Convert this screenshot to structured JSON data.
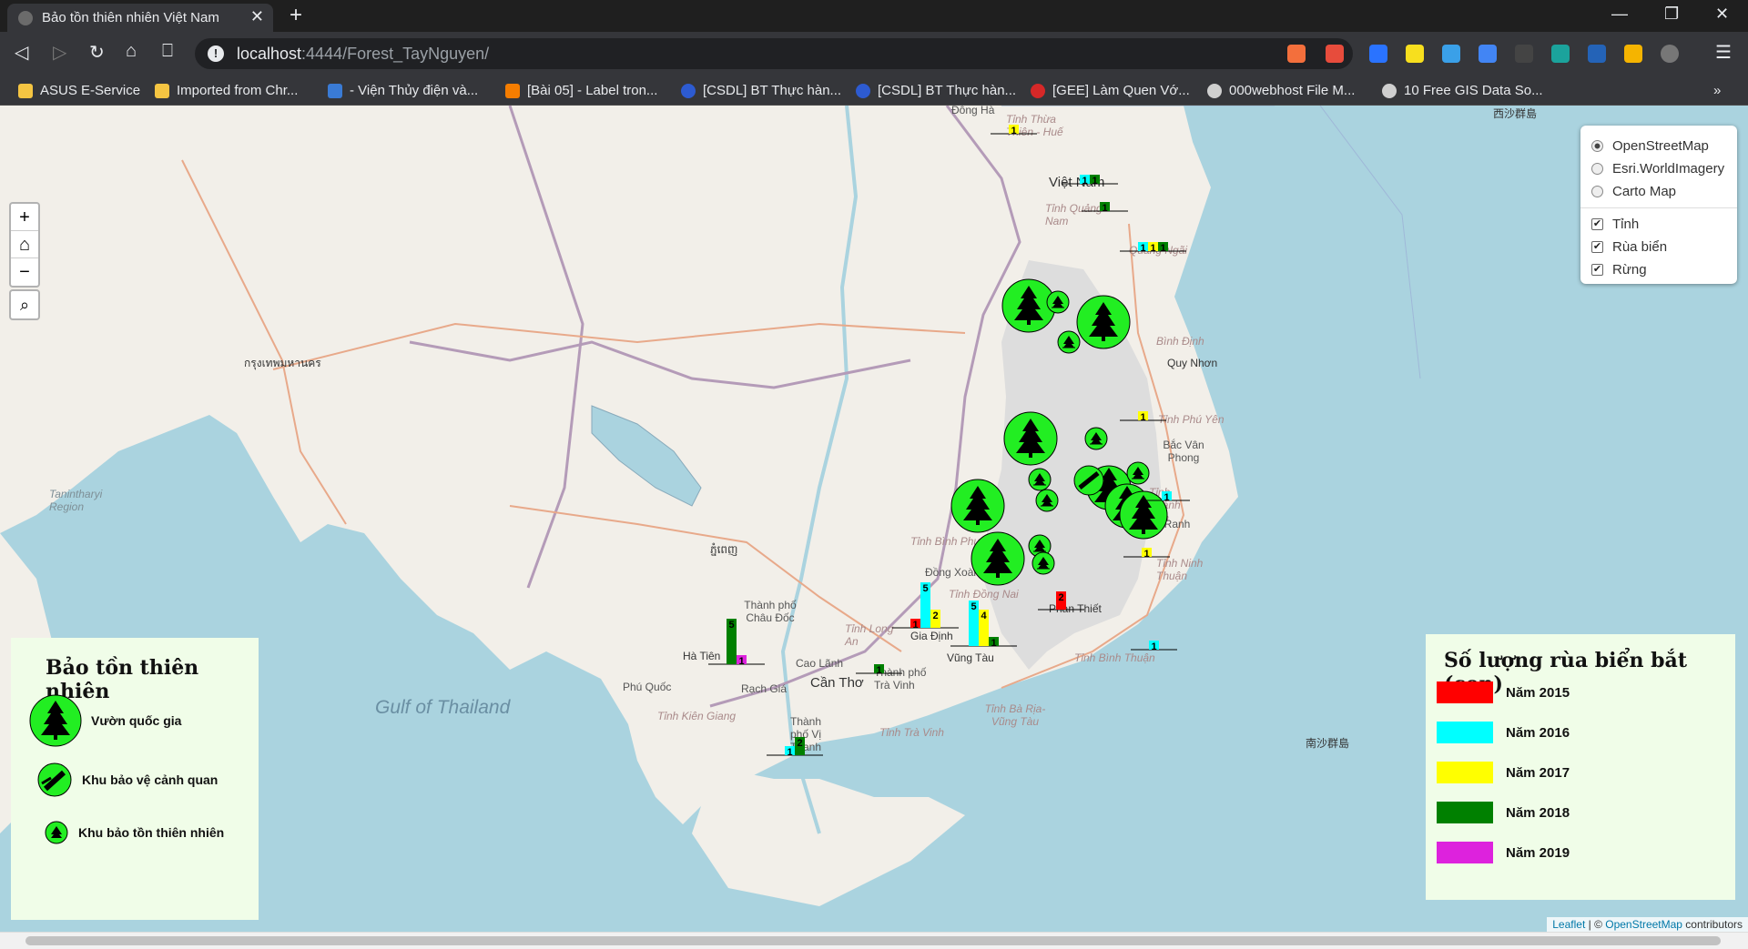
{
  "browser": {
    "tab_title": "Bảo tồn thiên nhiên Việt Nam",
    "url_host": "localhost",
    "url_rest": ":4444/Forest_TayNguyen/",
    "bookmarks": [
      "ASUS E-Service",
      "Imported from Chr...",
      "- Viện Thủy điện và...",
      "[Bài 05] - Label tron...",
      "[CSDL] BT Thực hàn...",
      "[CSDL] BT Thực hàn...",
      "[GEE] Làm Quen Vớ...",
      "000webhost File M...",
      "10 Free GIS Data So..."
    ],
    "more": "»"
  },
  "map_controls": {
    "zoom_in": "+",
    "home": "⌂",
    "zoom_out": "−"
  },
  "layer_control": {
    "base_layers": [
      {
        "label": "OpenStreetMap",
        "selected": true
      },
      {
        "label": "Esri.WorldImagery",
        "selected": false
      },
      {
        "label": "Carto Map",
        "selected": false
      }
    ],
    "overlays": [
      {
        "label": "Tỉnh",
        "checked": true
      },
      {
        "label": "Rùa biển",
        "checked": true
      },
      {
        "label": "Rừng",
        "checked": true
      }
    ]
  },
  "legend_conservation": {
    "title": "Bảo tồn thiên nhiên",
    "items": [
      "Vườn quốc gia",
      "Khu bảo vệ cảnh quan",
      "Khu bảo tồn thiên nhiên"
    ]
  },
  "legend_turtles": {
    "title": "Số lượng rùa biển bắt (con)",
    "items": [
      {
        "label": "Năm 2015",
        "color": "#ff0000"
      },
      {
        "label": "Năm 2016",
        "color": "#00ffff"
      },
      {
        "label": "Năm 2017",
        "color": "#ffff00"
      },
      {
        "label": "Năm 2018",
        "color": "#008000"
      },
      {
        "label": "Năm 2019",
        "color": "#dd22dd"
      }
    ]
  },
  "map_labels": {
    "places": [
      "Đông Hà",
      "Tỉnh Thừa Thiên - Huế",
      "Việt Nam",
      "Tỉnh Quảng Nam",
      "Quảng Ngãi",
      "Bình Định",
      "Quy Nhơn",
      "Tỉnh Phú Yên",
      "Bắc Vân Phong",
      "Tỉnh Khánh Hòa",
      "Cam Ranh",
      "Tỉnh Ninh Thuận",
      "Tỉnh Bình Thuận",
      "Phan Thiết",
      "Tỉnh Đồng Nai",
      "Vũng Tàu",
      "Gia Định",
      "Tỉnh Long An",
      "Thành phố Châu Đốc",
      "Hà Tiên",
      "Phú Quốc",
      "Rạch Giá",
      "Cao Lãnh",
      "Cần Thơ",
      "Thành phố Trà Vinh",
      "Tỉnh Bà Rịa-Vũng Tàu",
      "Tỉnh Kiên Giang",
      "Thành phố Vị Thanh",
      "Tỉnh Trà Vinh",
      "Gulf of Thailand",
      "Tanintharyi Region",
      "Tỉnh Bình Phước",
      "Đồng Xoài",
      "กรุงเทพมหานคร",
      "ភ្នំពេញ",
      "西沙群島",
      "南沙群島"
    ]
  },
  "turtle_bars": [
    {
      "place": "Thừa Thiên - Huế",
      "values": [
        {
          "year": "2017",
          "value": 1
        }
      ]
    },
    {
      "place": "Đà Nẵng",
      "values": [
        {
          "year": "2016",
          "value": 1
        },
        {
          "year": "2018",
          "value": 1
        }
      ]
    },
    {
      "place": "Quảng Nam",
      "values": [
        {
          "year": "2018",
          "value": 1
        }
      ]
    },
    {
      "place": "Quảng Ngãi",
      "values": [
        {
          "year": "2016",
          "value": 1
        },
        {
          "year": "2017",
          "value": 1
        },
        {
          "year": "2018",
          "value": 1
        }
      ]
    },
    {
      "place": "Phú Yên",
      "values": [
        {
          "year": "2017",
          "value": 1
        }
      ]
    },
    {
      "place": "Khánh Hòa",
      "values": [
        {
          "year": "2016",
          "value": 1
        }
      ]
    },
    {
      "place": "Ninh Thuận",
      "values": [
        {
          "year": "2017",
          "value": 1
        }
      ]
    },
    {
      "place": "Bình Thuận",
      "values": [
        {
          "year": "2016",
          "value": 1
        }
      ]
    },
    {
      "place": "Phan Thiết",
      "values": [
        {
          "year": "2015",
          "value": 2
        }
      ]
    },
    {
      "place": "Vũng Tàu",
      "values": [
        {
          "year": "2016",
          "value": 5
        },
        {
          "year": "2017",
          "value": 4
        },
        {
          "year": "2018",
          "value": 1
        }
      ]
    },
    {
      "place": "TP Hồ Chí Minh",
      "values": [
        {
          "year": "2015",
          "value": 1
        },
        {
          "year": "2016",
          "value": 5
        },
        {
          "year": "2017",
          "value": 2
        }
      ]
    },
    {
      "place": "Kiên Giang",
      "values": [
        {
          "year": "2018",
          "value": 5
        },
        {
          "year": "2019",
          "value": 1
        }
      ]
    },
    {
      "place": "Bến Tre",
      "values": [
        {
          "year": "2018",
          "value": 1
        }
      ]
    },
    {
      "place": "Sóc Trăng",
      "values": [
        {
          "year": "2016",
          "value": 1
        },
        {
          "year": "2018",
          "value": 2
        }
      ]
    }
  ],
  "attribution": {
    "leaflet": "Leaflet",
    "sep": " | © ",
    "osm": "OpenStreetMap",
    "rest": " contributors"
  }
}
